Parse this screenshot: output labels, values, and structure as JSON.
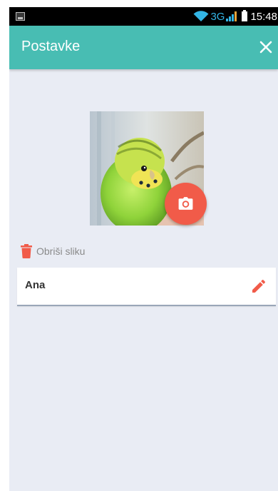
{
  "status_bar": {
    "network_label": "3G",
    "time": "15:48",
    "icons": [
      "image-notification-icon",
      "wifi-icon",
      "signal-icon",
      "battery-icon"
    ]
  },
  "app_bar": {
    "title": "Postavke",
    "close_icon": "close-icon"
  },
  "profile": {
    "photo": "budgie-photo",
    "camera_icon": "camera-icon",
    "delete_photo_label": "Obriši sliku",
    "delete_icon": "trash-icon",
    "name": "Ana",
    "edit_icon": "pencil-icon"
  },
  "colors": {
    "accent_teal": "#48bdb3",
    "action_red": "#f15b49",
    "background": "#e9ecf4",
    "network_blue": "#33b5e5"
  }
}
